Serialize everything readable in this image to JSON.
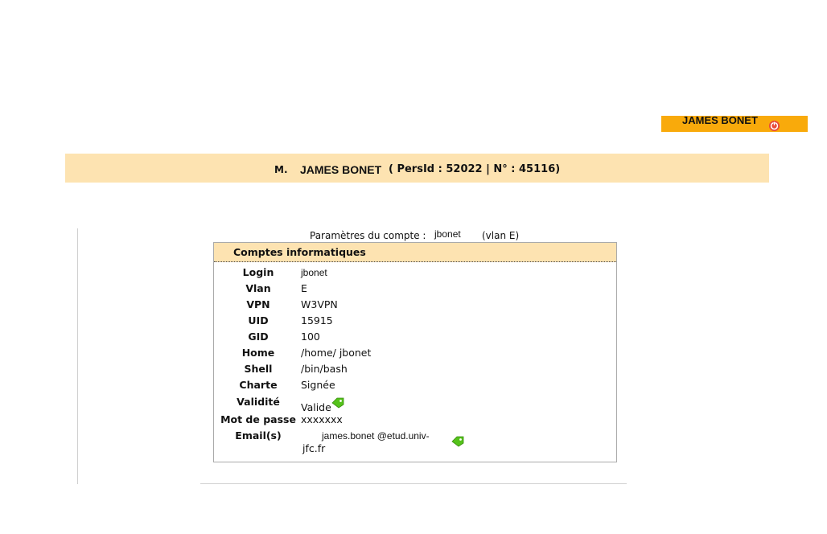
{
  "header": {
    "user_name": "JAMES BONET",
    "logout_icon": "power-icon",
    "badge_color": "#f9aa0b"
  },
  "person": {
    "civility": "M.",
    "name": "JAMES BONET",
    "ids": "( PersId : 52022 | N° : 45116)"
  },
  "params": {
    "label": "Paramètres du compte :",
    "login": "jbonet",
    "vlan": "(vlan E)"
  },
  "card": {
    "title": "Comptes informatiques",
    "rows": [
      {
        "label": "Login",
        "value": "jbonet"
      },
      {
        "label": "Vlan",
        "value": "E"
      },
      {
        "label": "VPN",
        "value": "W3VPN"
      },
      {
        "label": "UID",
        "value": "15915"
      },
      {
        "label": "GID",
        "value": "100"
      },
      {
        "label": "Home",
        "value": "/home/ jbonet"
      },
      {
        "label": "Shell",
        "value": "/bin/bash"
      },
      {
        "label": "Charte",
        "value": "Signée"
      },
      {
        "label": "Validité",
        "value": "Valide"
      },
      {
        "label": "Mot de passe",
        "value": "xxxxxxx"
      },
      {
        "label": "Email(s)",
        "value_line1": "james.bonet @etud.univ-",
        "value_line2": "jfc.fr"
      }
    ],
    "tag_icon": "tag-icon",
    "tag_color": "#55c21b"
  }
}
